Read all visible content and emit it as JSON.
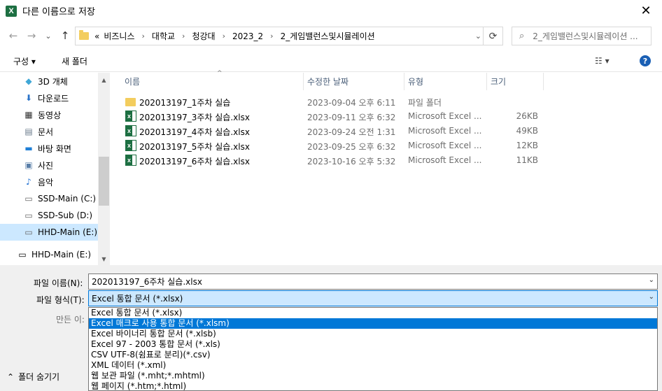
{
  "window": {
    "app_icon": "excel-icon",
    "title": "다른 이름으로 저장",
    "close": "✕"
  },
  "nav": {
    "back": "←",
    "forward": "→",
    "recent": "⌄",
    "up": "↑",
    "crumbs": [
      "«",
      "비즈니스",
      "대학교",
      "청강대",
      "2023_2",
      "2_게임밸런스및시뮬레이션"
    ],
    "refresh": "⟳",
    "search_placeholder": "2_게임밸런스및시뮬레이션 ..."
  },
  "toolbar": {
    "organize": "구성 ▾",
    "new_folder": "새 폴더",
    "view": "☷ ▾",
    "help": "?"
  },
  "sidebar": {
    "items": [
      {
        "label": "3D 개체",
        "icon": "cube-icon",
        "glyph": "◆",
        "color": "#3fa7d6"
      },
      {
        "label": "다운로드",
        "icon": "download-icon",
        "glyph": "⬇",
        "color": "#2a73c9"
      },
      {
        "label": "동영상",
        "icon": "film-icon",
        "glyph": "▦",
        "color": "#333333"
      },
      {
        "label": "문서",
        "icon": "document-icon",
        "glyph": "▤",
        "color": "#6b7b8c"
      },
      {
        "label": "바탕 화면",
        "icon": "desktop-icon",
        "glyph": "▬",
        "color": "#1f7fd6"
      },
      {
        "label": "사진",
        "icon": "picture-icon",
        "glyph": "▣",
        "color": "#5a7fa8"
      },
      {
        "label": "음악",
        "icon": "music-icon",
        "glyph": "♪",
        "color": "#1f6fd1"
      },
      {
        "label": "SSD-Main (C:)",
        "icon": "drive-icon",
        "glyph": "▭",
        "color": "#666666"
      },
      {
        "label": "SSD-Sub (D:)",
        "icon": "drive-icon",
        "glyph": "▭",
        "color": "#666666"
      },
      {
        "label": "HHD-Main (E:)",
        "icon": "drive-icon",
        "glyph": "▭",
        "color": "#666666"
      },
      {
        "label": "HHD-Main (E:)",
        "icon": "drive-icon",
        "glyph": "▭",
        "color": "#666666"
      }
    ]
  },
  "files": {
    "headers": [
      "이름",
      "수정한 날짜",
      "유형",
      "크기"
    ],
    "sort_indicator": "^",
    "rows": [
      {
        "name": "202013197_1주차 실습",
        "date": "2023-09-04 오후 6:11",
        "type": "파일 폴더",
        "size": "",
        "icon": "folder-icon"
      },
      {
        "name": "202013197_3주차 실습.xlsx",
        "date": "2023-09-11 오후 6:32",
        "type": "Microsoft Excel ...",
        "size": "26KB",
        "icon": "excel-file-icon"
      },
      {
        "name": "202013197_4주차 실습.xlsx",
        "date": "2023-09-24 오전 1:31",
        "type": "Microsoft Excel ...",
        "size": "49KB",
        "icon": "excel-file-icon"
      },
      {
        "name": "202013197_5주차 실습.xlsx",
        "date": "2023-09-25 오후 6:32",
        "type": "Microsoft Excel ...",
        "size": "12KB",
        "icon": "excel-file-icon"
      },
      {
        "name": "202013197_6주차 실습.xlsx",
        "date": "2023-10-16 오후 5:32",
        "type": "Microsoft Excel ...",
        "size": "11KB",
        "icon": "excel-file-icon"
      }
    ]
  },
  "form": {
    "filename_label": "파일 이름(N):",
    "filename_value": "202013197_6주차 실습.xlsx",
    "filetype_label": "파일 형식(T):",
    "filetype_value": "Excel 통합 문서 (*.xlsx)",
    "author_label": "만든 이:",
    "chevron": "⌄",
    "filetype_options": [
      "Excel 통합 문서 (*.xlsx)",
      "Excel 매크로 사용 통합 문서 (*.xlsm)",
      "Excel 바이너리 통합 문서 (*.xlsb)",
      "Excel 97 - 2003 통합 문서 (*.xls)",
      "CSV UTF-8(쉼표로 분리)(*.csv)",
      "XML 데이터 (*.xml)",
      "웹 보관 파일 (*.mht;*.mhtml)",
      "웹 페이지 (*.htm;*.html)"
    ],
    "highlighted_option": 1,
    "hide_folders": "폴더 숨기기",
    "hide_arrow": "⌃"
  }
}
